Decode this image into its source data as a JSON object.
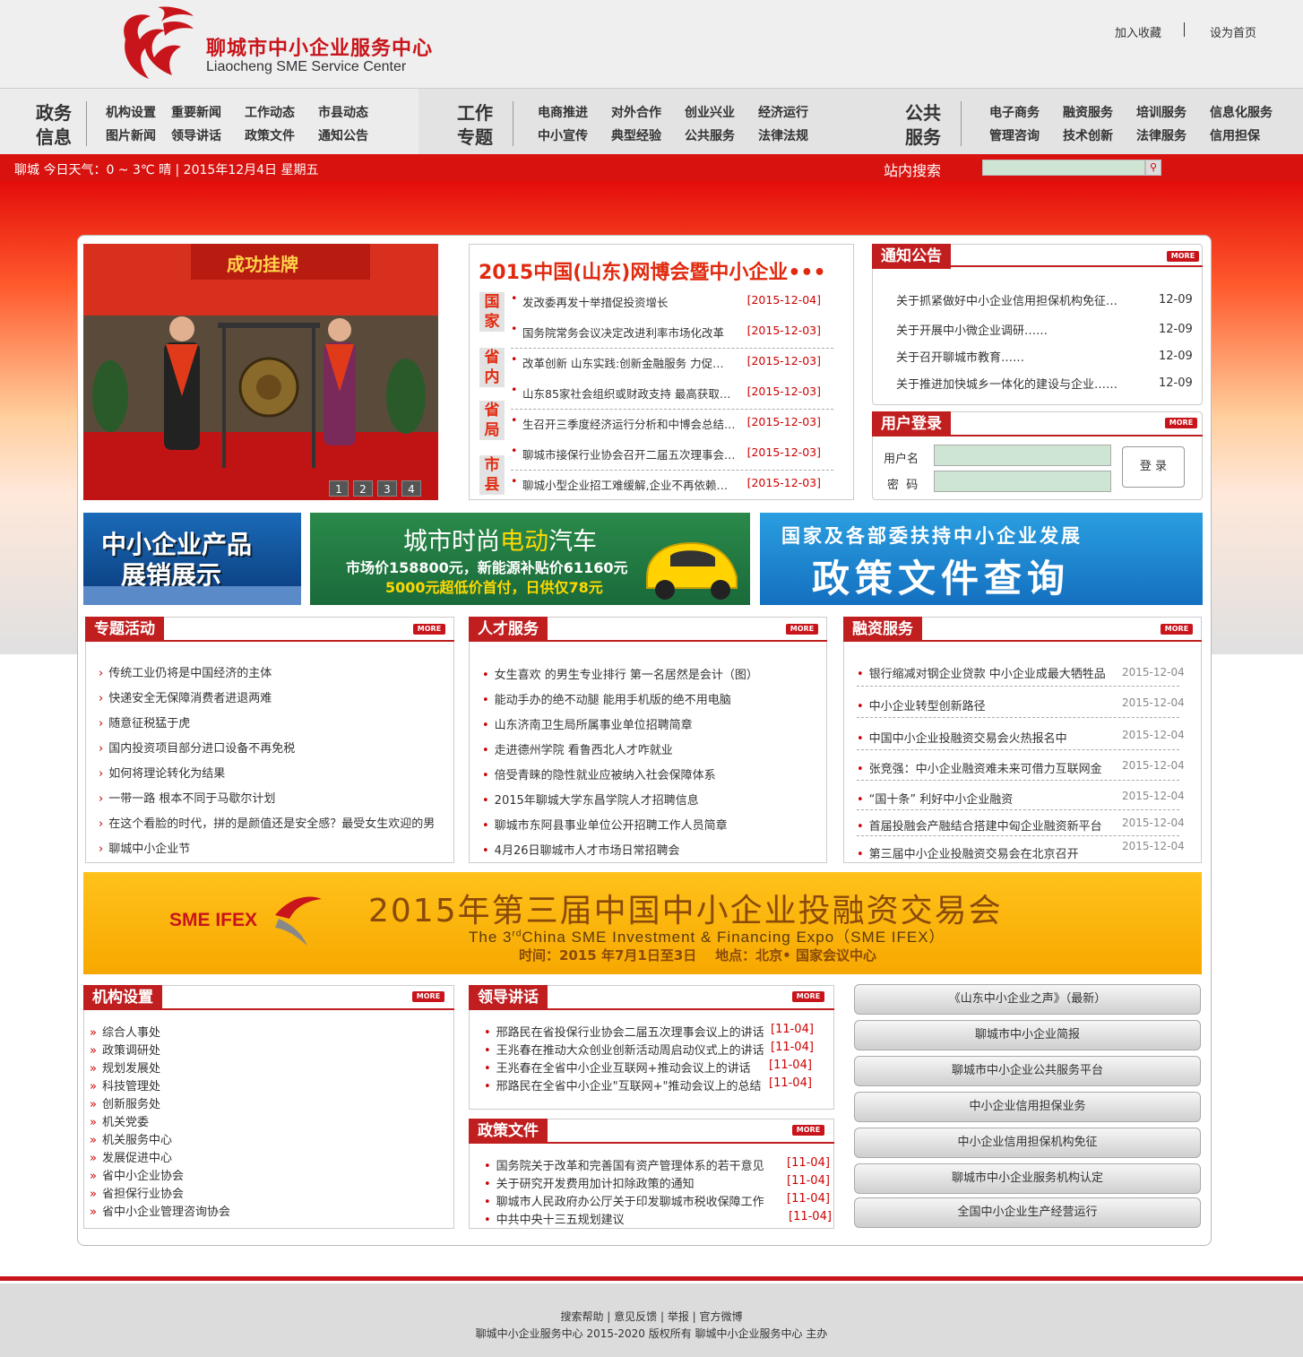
{
  "header": {
    "site_name_cn": "聊城市中小企业服务中心",
    "site_name_en": "Liaocheng SME Service Center",
    "add_favorite": "加入收藏",
    "set_homepage": "设为首页"
  },
  "nav": {
    "sections": [
      {
        "title_l1": "政务",
        "title_l2": "信息",
        "links": [
          "机构设置",
          "重要新闻",
          "工作动态",
          "市县动态",
          "图片新闻",
          "领导讲话",
          "政策文件",
          "通知公告"
        ]
      },
      {
        "title_l1": "工作",
        "title_l2": "专题",
        "links": [
          "电商推进",
          "对外合作",
          "创业兴业",
          "经济运行",
          "中小宣传",
          "典型经验",
          "公共服务",
          "法律法规"
        ]
      },
      {
        "title_l1": "公共",
        "title_l2": "服务",
        "links": [
          "电子商务",
          "融资服务",
          "培训服务",
          "信息化服务",
          "管理咨询",
          "技术创新",
          "法律服务",
          "信用担保"
        ]
      }
    ]
  },
  "infobar": {
    "weather": "聊城 今日天气：0 ~ 3℃ 晴 |  2015年12月4日 星期五",
    "search_label": "站内搜索",
    "search_icon": "search-icon"
  },
  "slider": {
    "banner_text": "成功挂牌",
    "pages": [
      "1",
      "2",
      "3",
      "4"
    ]
  },
  "headline": {
    "title": "2015中国(山东)网博会暨中小企业•••",
    "categories": [
      {
        "l1": "国",
        "l2": "家"
      },
      {
        "l1": "省",
        "l2": "内"
      },
      {
        "l1": "省",
        "l2": "局"
      },
      {
        "l1": "市",
        "l2": "县"
      }
    ],
    "items": [
      {
        "title": "发改委再发十举措促投资增长",
        "date": "[2015-12-04]"
      },
      {
        "title": "国务院常务会议决定改进利率市场化改革",
        "date": "[2015-12-03]"
      },
      {
        "title": "改革创新 山东实践:创新金融服务 力促…",
        "date": "[2015-12-03]"
      },
      {
        "title": "山东85家社会组织或财政支持 最高获取…",
        "date": "[2015-12-03]"
      },
      {
        "title": "生召开三季度经济运行分析和中博会总结…",
        "date": "[2015-12-03]"
      },
      {
        "title": "聊城市接保行业协会召开二届五次理事会…",
        "date": "[2015-12-03]"
      },
      {
        "title": "聊城小型企业招工难缓解,企业不再依赖…",
        "date": "[2015-12-03]"
      }
    ]
  },
  "notice": {
    "title": "通知公告",
    "more": "MORE",
    "items": [
      {
        "title": "关于抓紧做好中小企业信用担保机构免征…",
        "date": "12-09"
      },
      {
        "title": "关于开展中小微企业调研……",
        "date": "12-09"
      },
      {
        "title": "关于召开聊城市教育……",
        "date": "12-09"
      },
      {
        "title": "关于推进加快城乡一体化的建设与企业……",
        "date": "12-09"
      }
    ]
  },
  "login": {
    "title": "用户登录",
    "more": "MORE",
    "username_label": "用户名",
    "password_label": "密  码",
    "submit": "登 录"
  },
  "banners": {
    "b1_l1": "中小企业产品",
    "b1_l2": "展销展示",
    "b2_l1a": "城市时尚",
    "b2_l1b": "电动",
    "b2_l1c": "汽车",
    "b2_l2": "市场价158800元，新能源补贴价61160元",
    "b2_l3": "5000元超低价首付，日供仅78元",
    "b3_l1": "国家及各部委扶持中小企业发展",
    "b3_l2": "政策文件查询"
  },
  "special": {
    "title": "专题活动",
    "more": "MORE",
    "items": [
      "传统工业仍将是中国经济的主体",
      "快递安全无保障消费者进退两难",
      "随意征税猛于虎",
      "国内投资项目部分进口设备不再免税",
      "如何将理论转化为结果",
      "一带一路 根本不同于马歇尔计划",
      "在这个看脸的时代，拼的是颜值还是安全感？最受女生欢迎的男",
      "聊城中小企业节"
    ]
  },
  "talent": {
    "title": "人才服务",
    "more": "MORE",
    "items": [
      "女生喜欢 的男生专业排行 第一名居然是会计（图）",
      "能动手办的绝不动腿 能用手机版的绝不用电脑",
      "山东济南卫生局所属事业单位招聘简章",
      "走进德州学院 看鲁西北人才咋就业",
      "倍受青睐的隐性就业应被纳入社会保障体系",
      "2015年聊城大学东昌学院人才招聘信息",
      "聊城市东阿县事业单位公开招聘工作人员简章",
      "4月26日聊城市人才市场日常招聘会"
    ]
  },
  "finance": {
    "title": "融资服务",
    "more": "MORE",
    "items": [
      {
        "title": "银行缩减对钢企业贷款 中小企业成最大牺牲品",
        "date": "2015-12-04"
      },
      {
        "title": "中小企业转型创新路径",
        "date": "2015-12-04"
      },
      {
        "title": "中国中小企业投融资交易会火热报名中",
        "date": "2015-12-04"
      },
      {
        "title": "张竞强：中小企业融资难未来可借力互联网金",
        "date": "2015-12-04"
      },
      {
        "title": "“国十条” 利好中小企业融资",
        "date": "2015-12-04"
      },
      {
        "title": "首届投融会产融结合搭建中匈企业融资新平台",
        "date": "2015-12-04"
      },
      {
        "title": "第三届中小企业投融资交易会在北京召开",
        "date": "2015-12-04"
      }
    ]
  },
  "expo": {
    "logo": "SME IFEX",
    "title": "2015年第三届中国中小企业投融资交易会",
    "subtitle_pre": "The 3",
    "subtitle_sup": "rd",
    "subtitle_post": "China SME Investment & Financing Expo（SME IFEX）",
    "time_place": "时间：2015 年7月1日至3日    地点：北京• 国家会议中心"
  },
  "org": {
    "title": "机构设置",
    "more": "MORE",
    "items": [
      "综合人事处",
      "政策调研处",
      "规划发展处",
      "科技管理处",
      "创新服务处",
      "机关党委",
      "机关服务中心",
      "发展促进中心",
      "省中小企业协会",
      "省担保行业协会",
      "省中小企业管理咨询协会"
    ]
  },
  "speech": {
    "title": "领导讲话",
    "more": "MORE",
    "items": [
      {
        "title": "邢路民在省投保行业协会二届五次理事会议上的讲话",
        "date": "[11-04]"
      },
      {
        "title": "王兆春在推动大众创业创新活动周启动仪式上的讲话",
        "date": "[11-04]"
      },
      {
        "title": "王兆春在全省中小企业互联网+推动会议上的讲话",
        "date": "[11-04]"
      },
      {
        "title": "邢路民在全省中小企业\"互联网+\"推动会议上的总结",
        "date": "[11-04]"
      }
    ]
  },
  "policy": {
    "title": "政策文件",
    "more": "MORE",
    "items": [
      {
        "title": "国务院关于改革和完善国有资产管理体系的若干意见",
        "date": "[11-04]"
      },
      {
        "title": "关于研究开发费用加计扣除政策的通知",
        "date": "[11-04]"
      },
      {
        "title": "聊城市人民政府办公厅关于印发聊城市税收保障工作",
        "date": "[11-04]"
      },
      {
        "title": "中共中央十三五规划建议",
        "date": "[11-04]"
      }
    ]
  },
  "quicklinks": [
    "《山东中小企业之声》（最新）",
    "聊城市中小企业简报",
    "聊城市中小企业公共服务平台",
    "中小企业信用担保业务",
    "中小企业信用担保机构免征",
    "聊城市中小企业服务机构认定",
    "全国中小企业生产经营运行"
  ],
  "footer": {
    "links": "搜索帮助 | 意见反馈 | 举报 | 官方微博",
    "copyright": "聊城中小企业服务中心 2015-2020 版权所有 聊城中小企业服务中心 主办"
  },
  "colors": {
    "brand_red": "#c8151b",
    "bar_red": "#d8120f",
    "headline_orange": "#e02a0f"
  }
}
